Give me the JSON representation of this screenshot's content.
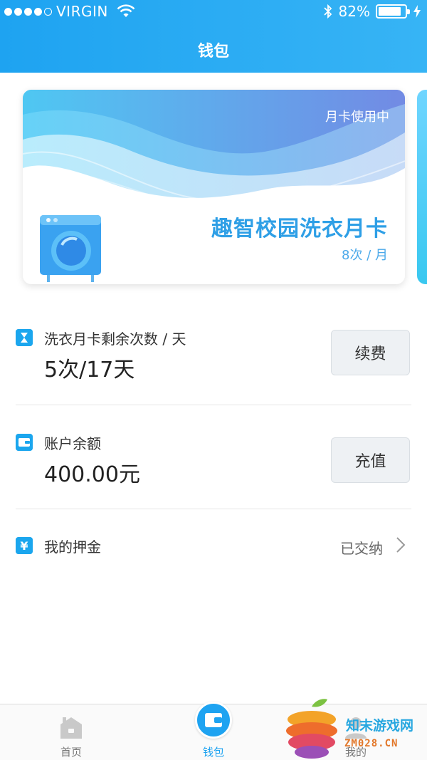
{
  "statusbar": {
    "signal_dots": 5,
    "signal_filled": 4,
    "carrier": "VIRGIN",
    "battery_percent": "82%",
    "battery_level": 0.82
  },
  "header": {
    "title": "钱包"
  },
  "card": {
    "badge": "月卡使用中",
    "title": "趣智校园洗衣月卡",
    "subtitle": "8次 / 月",
    "colors": {
      "wave_light": "#bfe7fb",
      "wave_mid": "#7cc8f5",
      "wave_dark": "#5b7fe0",
      "accent": "#2e9fe6"
    }
  },
  "rows": {
    "monthly": {
      "label": "洗衣月卡剩余次数 / 天",
      "value": "5次/17天",
      "button": "续费",
      "icon": "hourglass-icon"
    },
    "balance": {
      "label": "账户余额",
      "value": "400.00元",
      "button": "充值",
      "icon": "wallet-icon"
    },
    "deposit": {
      "label": "我的押金",
      "status": "已交纳",
      "icon": "yen-icon"
    }
  },
  "tabbar": {
    "tabs": [
      {
        "label": "首页",
        "icon": "home-icon",
        "active": false
      },
      {
        "label": "钱包",
        "icon": "wallet-icon",
        "active": true
      },
      {
        "label": "我的",
        "icon": "user-icon",
        "active": false
      }
    ],
    "active_color": "#1ea3f1"
  },
  "watermark": {
    "text": "知末游戏网",
    "url": "ZM028.CN"
  }
}
